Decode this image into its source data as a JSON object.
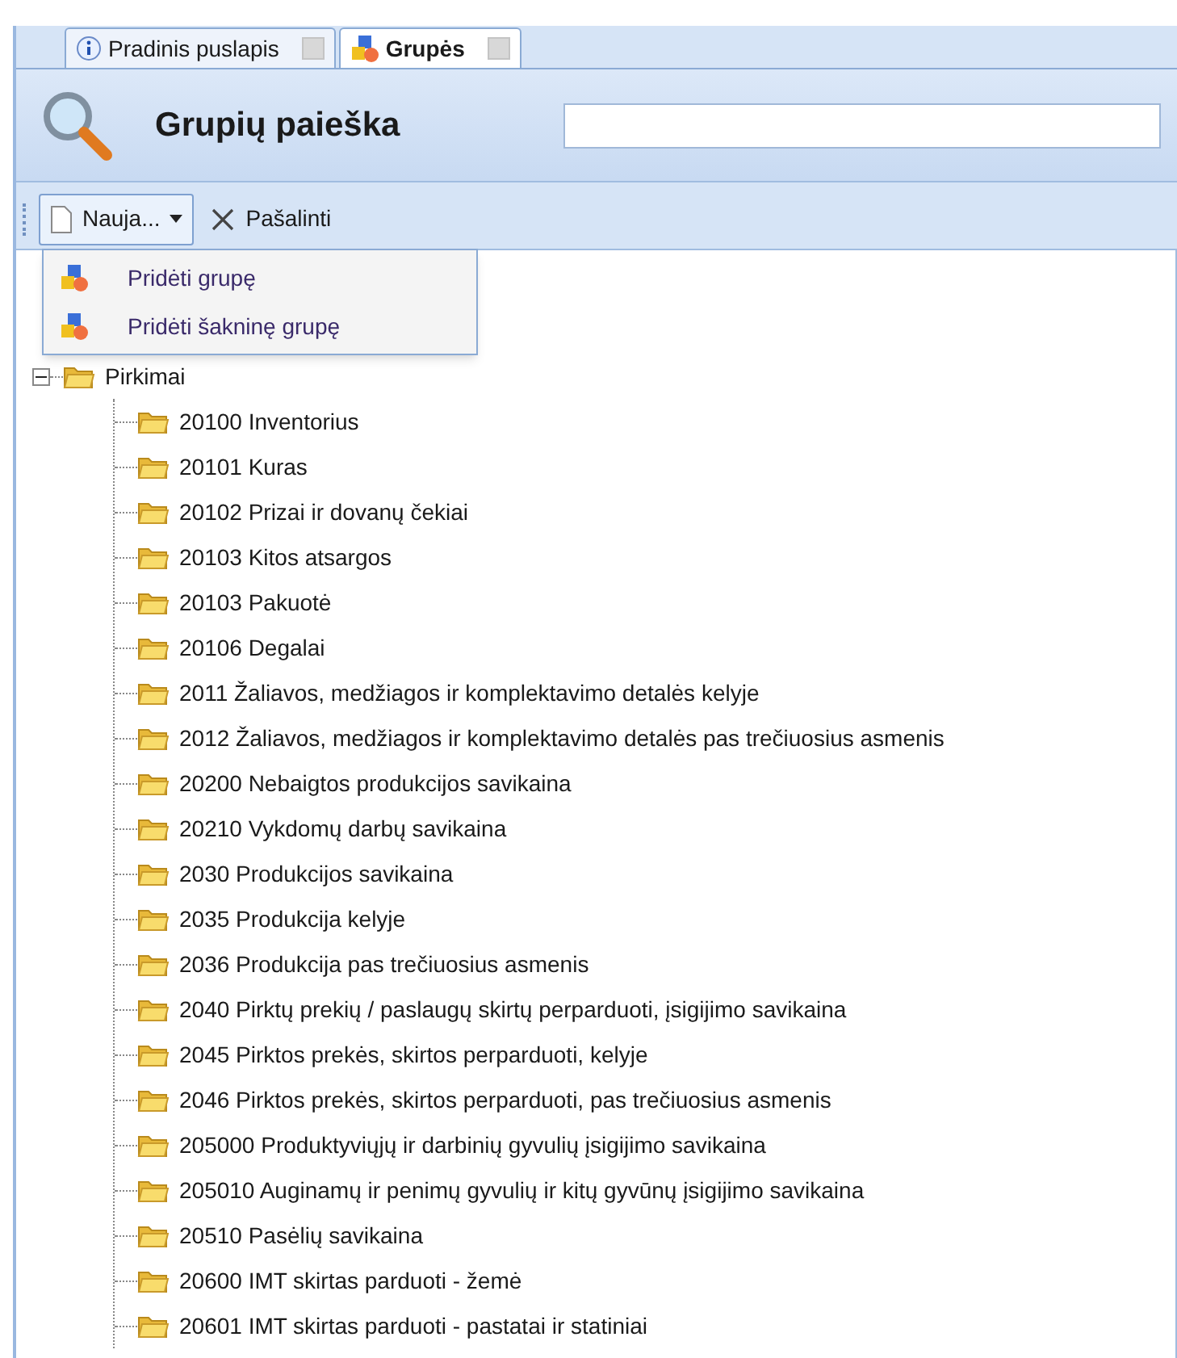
{
  "tabs": [
    {
      "label": "Pradinis puslapis",
      "selected": false,
      "kind": "info"
    },
    {
      "label": "Grupės",
      "selected": true,
      "kind": "groups"
    }
  ],
  "header": {
    "title": "Grupių paieška"
  },
  "toolbar": {
    "new_button": "Nauja...",
    "delete_button": "Pašalinti"
  },
  "menu": {
    "open": true,
    "items": [
      "Pridėti grupę",
      "Pridėti šakninę grupę"
    ]
  },
  "tree": [
    {
      "label": "Pirkimai",
      "expanded": true,
      "children": [
        {
          "label": "20100 Inventorius"
        },
        {
          "label": "20101 Kuras"
        },
        {
          "label": "20102 Prizai ir dovanų čekiai"
        },
        {
          "label": "20103 Kitos atsargos"
        },
        {
          "label": "20103 Pakuotė"
        },
        {
          "label": "20106 Degalai"
        },
        {
          "label": "2011 Žaliavos, medžiagos ir komplektavimo detalės kelyje"
        },
        {
          "label": "2012 Žaliavos, medžiagos ir komplektavimo detalės pas trečiuosius asmenis"
        },
        {
          "label": "20200 Nebaigtos produkcijos savikaina"
        },
        {
          "label": "20210 Vykdomų darbų savikaina"
        },
        {
          "label": "2030 Produkcijos savikaina"
        },
        {
          "label": "2035 Produkcija kelyje"
        },
        {
          "label": "2036 Produkcija pas trečiuosius asmenis"
        },
        {
          "label": "2040 Pirktų prekių / paslaugų skirtų perparduoti, įsigijimo savikaina"
        },
        {
          "label": "2045 Pirktos prekės, skirtos perparduoti, kelyje"
        },
        {
          "label": "2046 Pirktos prekės, skirtos perparduoti, pas trečiuosius asmenis"
        },
        {
          "label": "205000 Produktyviųjų ir darbinių gyvulių įsigijimo savikaina"
        },
        {
          "label": "205010 Auginamų ir penimų gyvulių ir kitų gyvūnų įsigijimo savikaina"
        },
        {
          "label": "20510 Pasėlių savikaina"
        },
        {
          "label": "20600 IMT skirtas parduoti - žemė"
        },
        {
          "label": "20601 IMT skirtas parduoti - pastatai ir statiniai"
        }
      ]
    }
  ]
}
